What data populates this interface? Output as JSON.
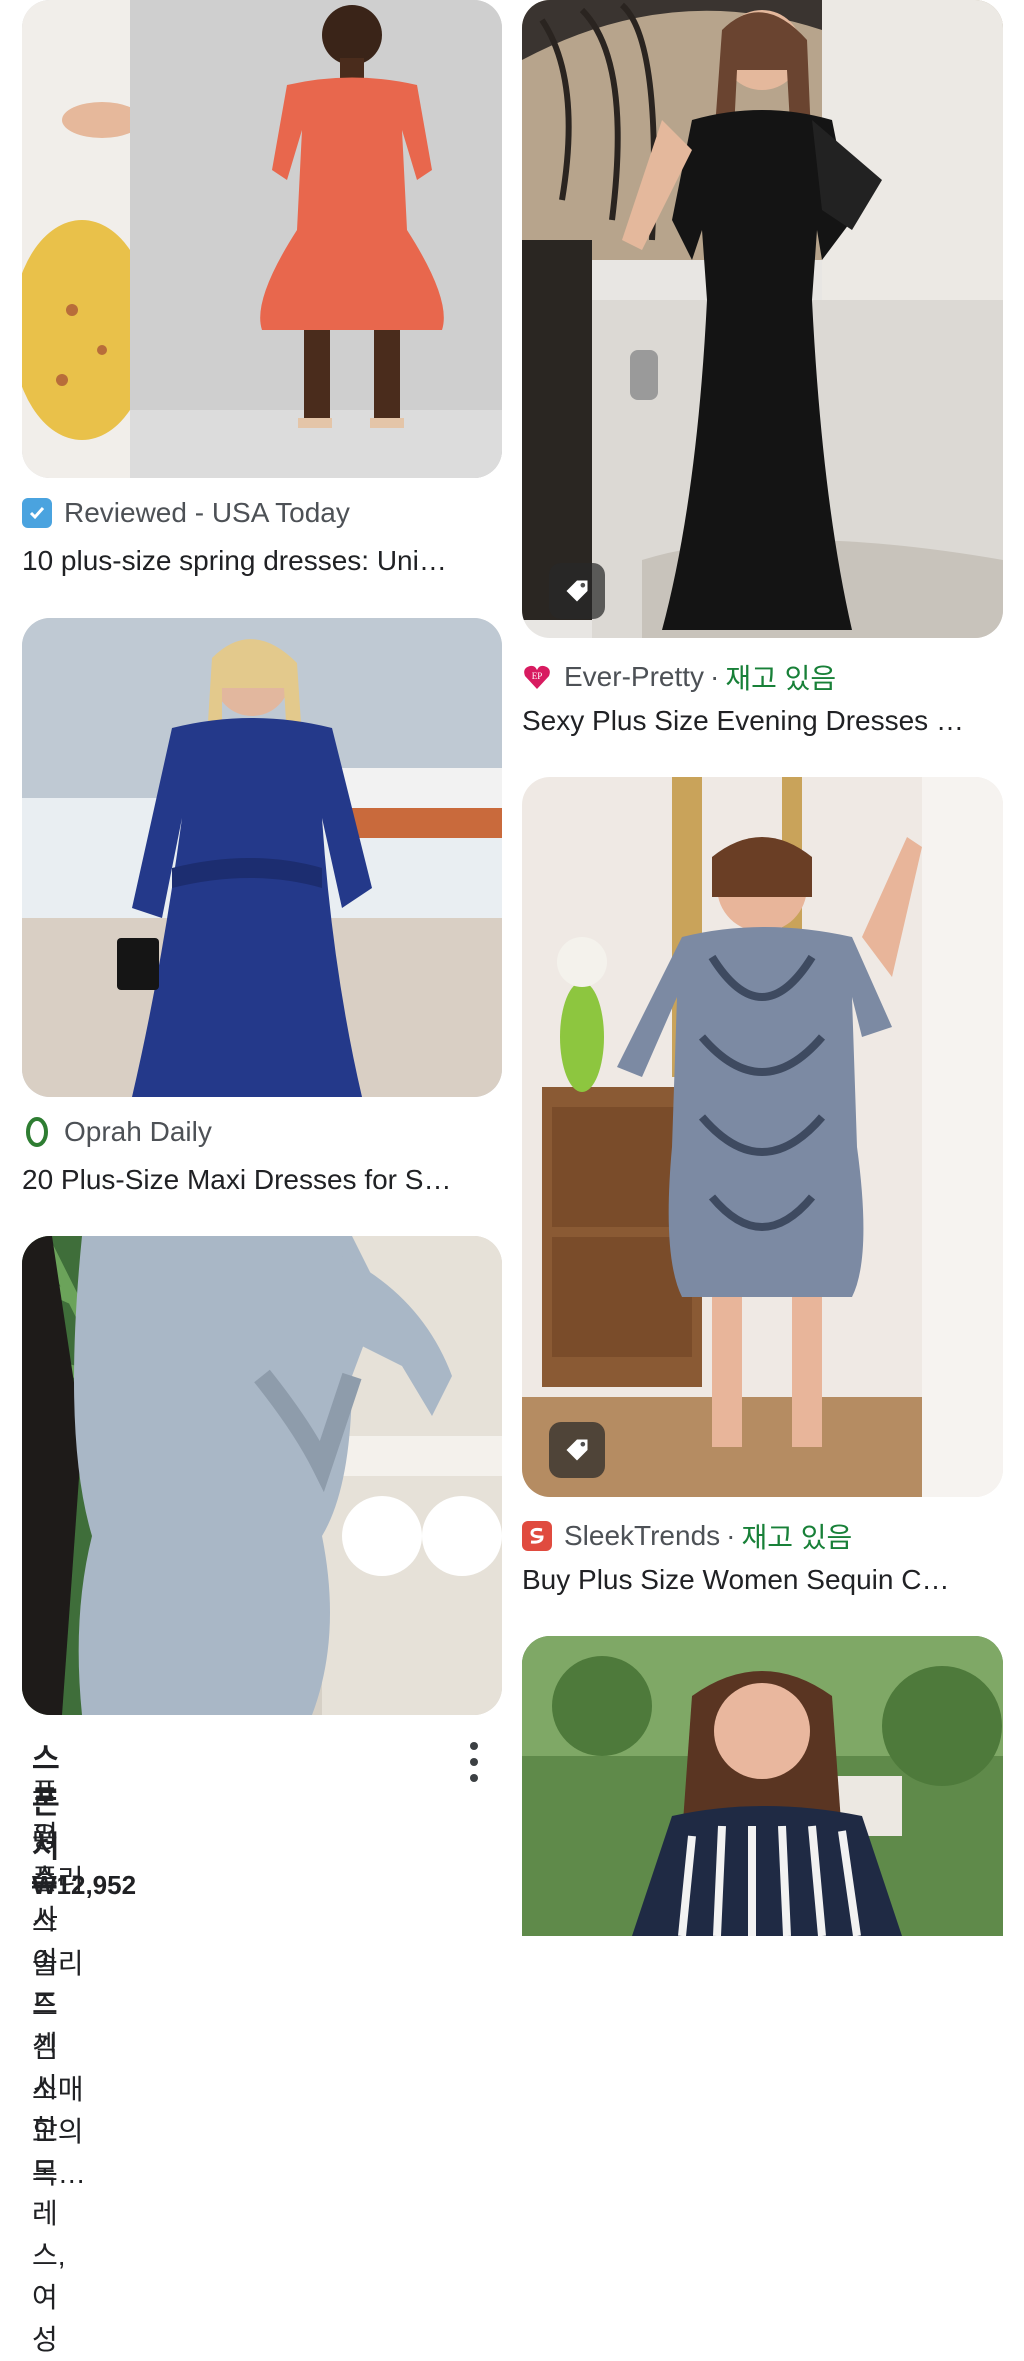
{
  "results": [
    {
      "source": "Reviewed - USA Today",
      "title": "10 plus-size spring dresses: Uni…",
      "favicon": "check-badge-icon"
    },
    {
      "source": "Ever-Pretty",
      "stock": "재고 있음",
      "title": "Sexy Plus Size Evening Dresses …",
      "favicon": "ep-heart-icon"
    },
    {
      "source": "Oprah Daily",
      "title": "20 Plus-Size Maxi Dresses for S…",
      "favicon": "oprah-o-icon"
    },
    {
      "source": "SleekTrends",
      "stock": "재고 있음",
      "title": "Buy Plus Size Women Sequin C…",
      "favicon": "sleektrends-icon"
    }
  ],
  "sponsored": {
    "label": "스폰서",
    "line1": "플러스 사이즈 섹시한 드레스, 여성",
    "line2": "용 플러스 솔리드 긴 소매 모의 목…",
    "price": "₩12,952"
  },
  "separator": "·",
  "colors": {
    "stock": "#188038",
    "text": "#202124",
    "meta": "#4d5156"
  }
}
